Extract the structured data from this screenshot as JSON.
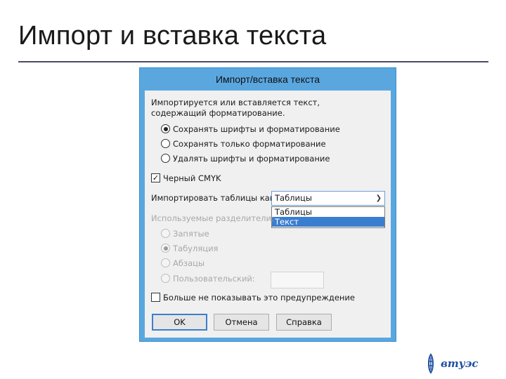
{
  "slide": {
    "title": "Импорт и вставка текста"
  },
  "dialog": {
    "title": "Импорт/вставка текста",
    "message_line1": "Импортируется или вставляется текст,",
    "message_line2": "содержащий форматирование.",
    "format_options": [
      {
        "label": "Сохранять шрифты и форматирование",
        "checked": true
      },
      {
        "label": "Сохранять только форматирование",
        "checked": false
      },
      {
        "label": "Удалять шрифты и форматирование",
        "checked": false
      }
    ],
    "black_cmyk": {
      "label": "Черный CMYK",
      "checked": true
    },
    "import_tables": {
      "label": "Импортировать таблицы как:",
      "selected": "Таблицы",
      "options": [
        "Таблицы",
        "Текст"
      ],
      "highlighted": "Текст"
    },
    "delimiters": {
      "label": "Используемые разделители:",
      "options": [
        {
          "label": "Запятые",
          "checked": false
        },
        {
          "label": "Табуляция",
          "checked": true
        },
        {
          "label": "Абзацы",
          "checked": false
        },
        {
          "label": "Пользовательский:",
          "checked": false
        }
      ]
    },
    "dont_show": {
      "label": "Больше не показывать это предупреждение",
      "checked": false
    },
    "buttons": {
      "ok": "OK",
      "cancel": "Отмена",
      "help": "Справка"
    }
  },
  "logo": {
    "text": "втуэс"
  },
  "colors": {
    "dialog_frame": "#5aa7e0",
    "dialog_body": "#f0f0f0",
    "selection": "#3a7ed0",
    "title_rule": "#4a4a6a",
    "logo_blue": "#1f4fa0"
  }
}
